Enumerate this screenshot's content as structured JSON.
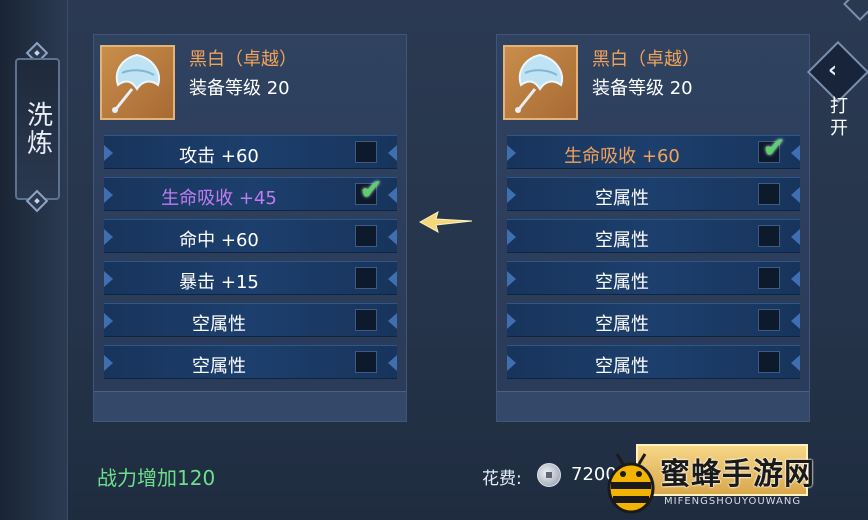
{
  "sidebar": {
    "wash_tab_label": "洗炼"
  },
  "left_panel": {
    "item": {
      "name": "黑白（卓越）",
      "level": "装备等级 20"
    },
    "attributes": [
      {
        "text": "攻击 +60",
        "color": "white",
        "checked": false
      },
      {
        "text": "生命吸收 +45",
        "color": "purple",
        "checked": true
      },
      {
        "text": "命中 +60",
        "color": "white",
        "checked": false
      },
      {
        "text": "暴击 +15",
        "color": "white",
        "checked": false
      },
      {
        "text": "空属性",
        "color": "white",
        "checked": false
      },
      {
        "text": "空属性",
        "color": "white",
        "checked": false
      }
    ]
  },
  "right_panel": {
    "item": {
      "name": "黑白（卓越）",
      "level": "装备等级 20"
    },
    "attributes": [
      {
        "text": "生命吸收 +60",
        "color": "orange",
        "checked": true
      },
      {
        "text": "空属性",
        "color": "white",
        "checked": false
      },
      {
        "text": "空属性",
        "color": "white",
        "checked": false
      },
      {
        "text": "空属性",
        "color": "white",
        "checked": false
      },
      {
        "text": "空属性",
        "color": "white",
        "checked": false
      },
      {
        "text": "空属性",
        "color": "white",
        "checked": false
      }
    ]
  },
  "open_button_label": "打开",
  "footer": {
    "power_increase": "战力增加120",
    "cost_label": "花费:",
    "cost_value": "7200",
    "currency_icon": "silver-coin-icon"
  },
  "watermark": {
    "title": "蜜蜂手游网",
    "subtitle": "MIFENGSHOUYOUWANG"
  },
  "colors": {
    "attr_purple": "#c07cf0",
    "attr_orange": "#f0a35a",
    "power_green": "#6be08a",
    "check_green": "#58d36a"
  }
}
